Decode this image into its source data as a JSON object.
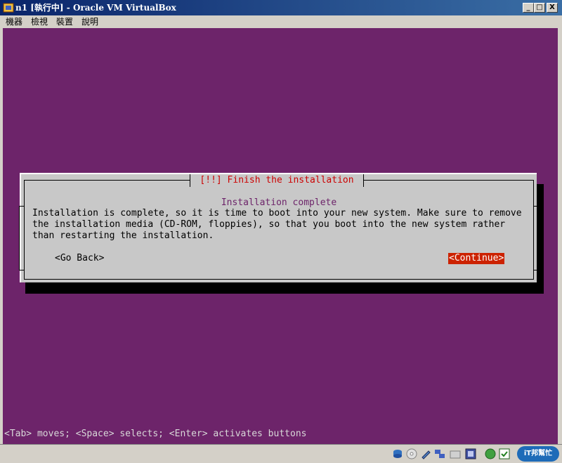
{
  "window": {
    "title": "n1 [執行中] - Oracle VM VirtualBox",
    "controls": {
      "minimize": "_",
      "maximize": "□",
      "close": "X"
    }
  },
  "menubar": {
    "items": [
      "機器",
      "檢視",
      "裝置",
      "說明"
    ]
  },
  "installer": {
    "dialog_title": "[!!] Finish the installation",
    "subtitle": "Installation complete",
    "message": "Installation is complete, so it is time to boot into your new system. Make sure to remove\nthe installation media (CD-ROM, floppies), so that you boot into the new system rather\nthan restarting the installation.",
    "buttons": {
      "back": "<Go Back>",
      "continue": "<Continue>"
    },
    "hint": "<Tab> moves; <Space> selects; <Enter> activates buttons"
  },
  "statusbar": {
    "icons": [
      "hard-disk-icon",
      "cd-rom-icon",
      "usb-icon",
      "network-icon",
      "shared-folder-icon",
      "display-icon",
      "capture-icon",
      "host-key-icon"
    ],
    "host_key": "iT邦幫忙"
  },
  "colors": {
    "screen_bg": "#6d246a",
    "dialog_bg": "#c8c8c8",
    "title_red": "#cc0000",
    "button_selected": "#cc2200"
  }
}
